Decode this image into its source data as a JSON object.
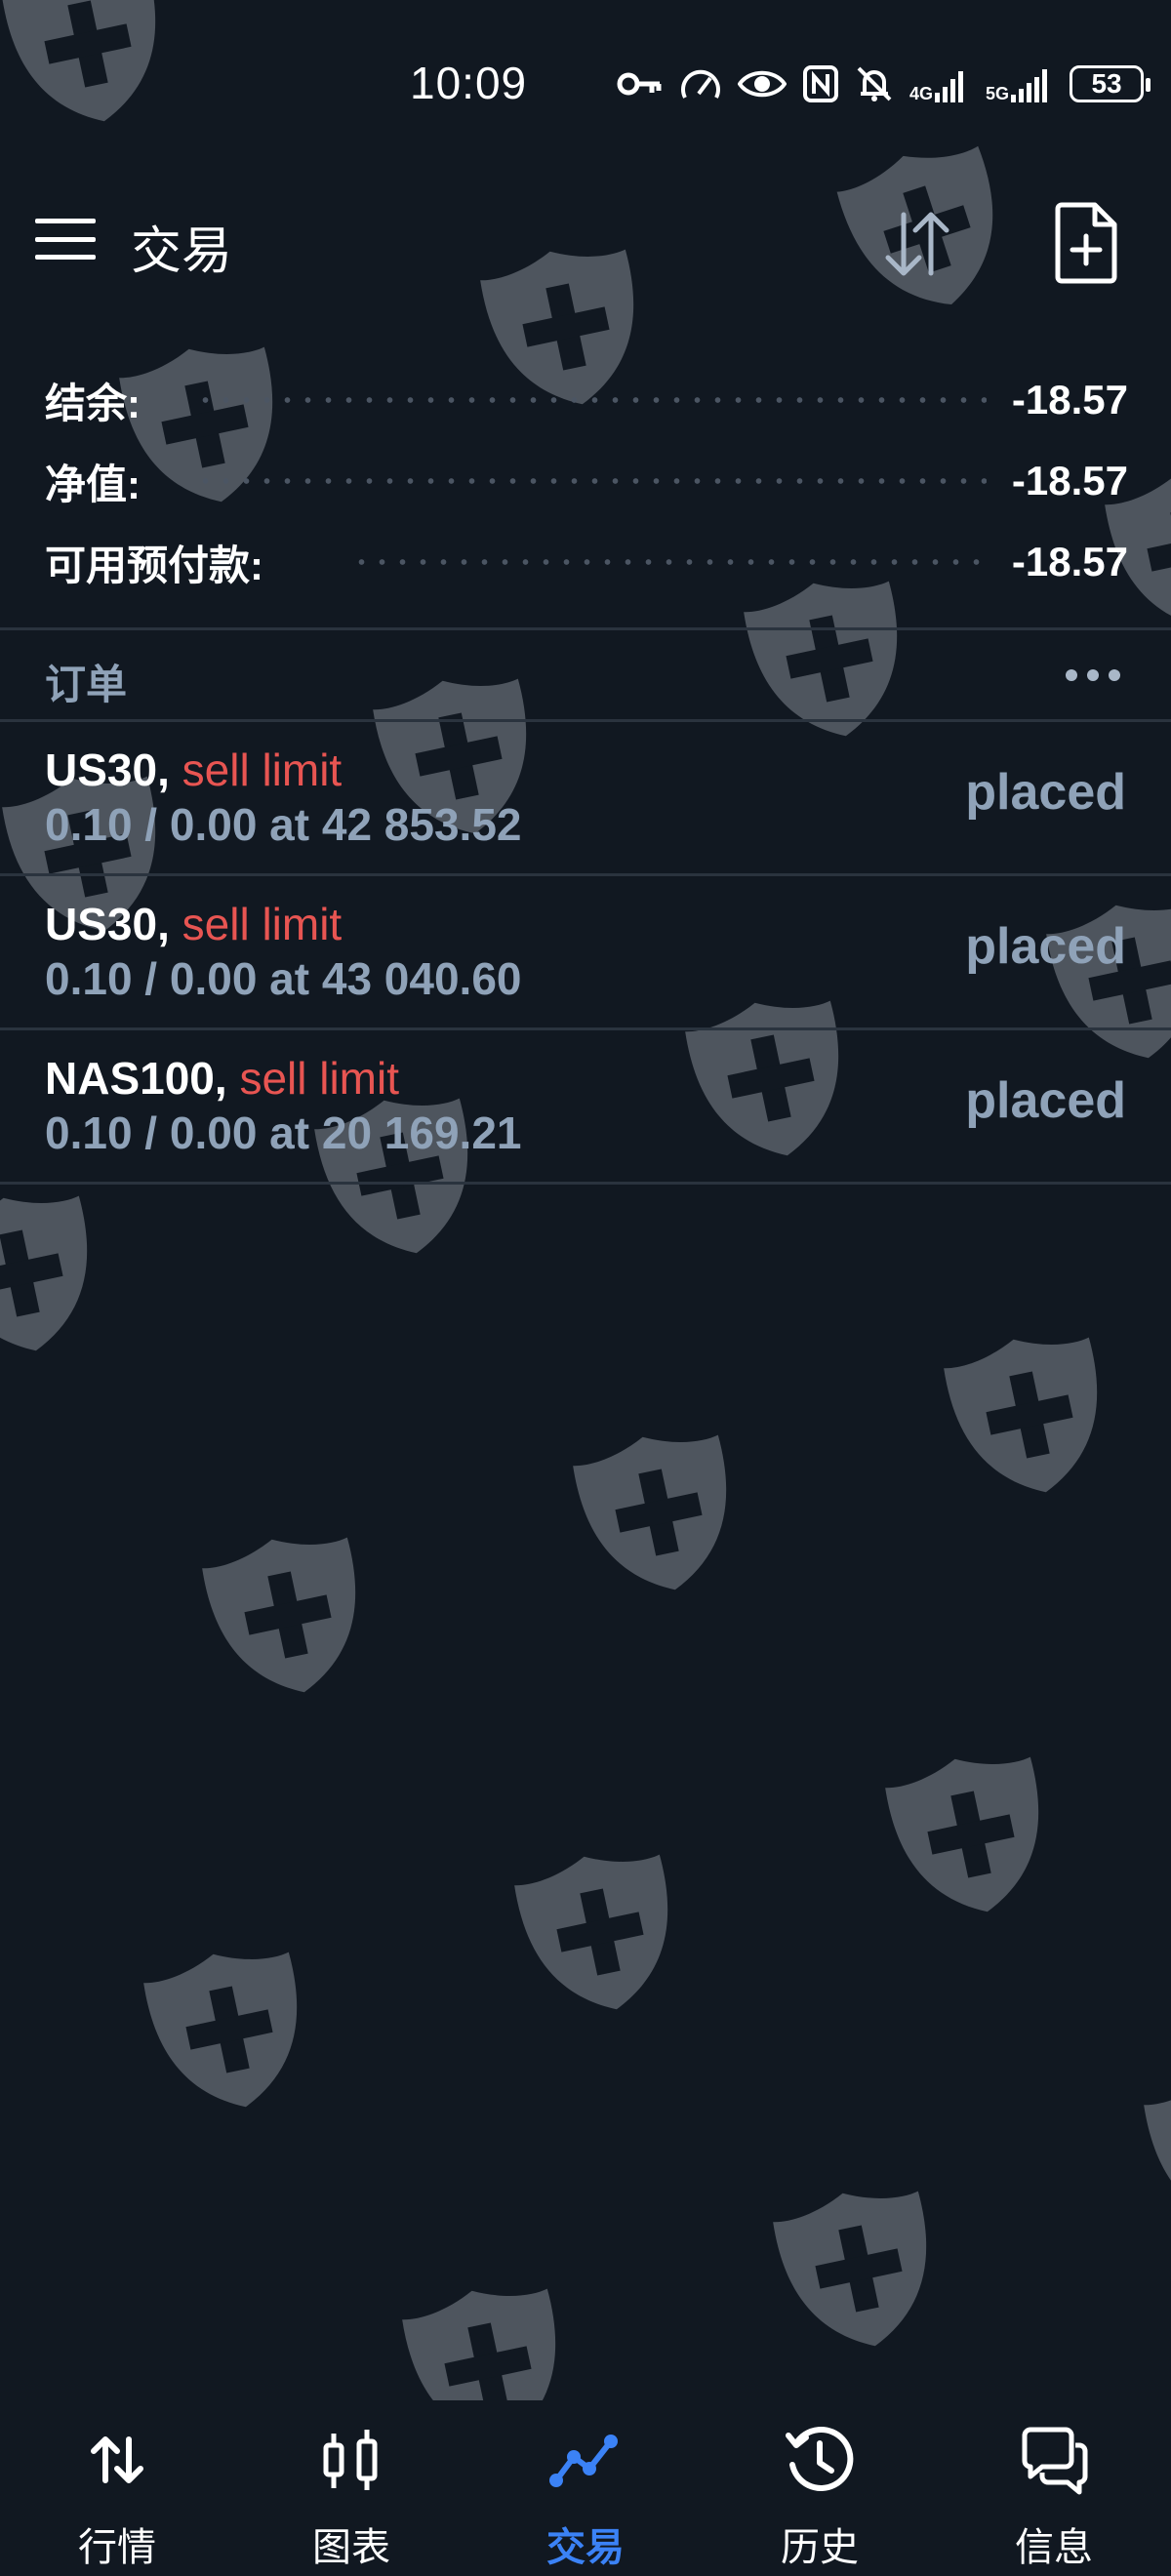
{
  "status_bar": {
    "time": "10:09",
    "net1": "4G",
    "net2": "5G",
    "battery": "53"
  },
  "app_bar": {
    "title": "交易"
  },
  "summary": [
    {
      "label": "结余:",
      "value": "-18.57"
    },
    {
      "label": "净值:",
      "value": "-18.57"
    },
    {
      "label": "可用预付款:",
      "value": "-18.57"
    }
  ],
  "orders_section": {
    "title": "订单"
  },
  "orders": [
    {
      "symbol": "US30,",
      "type": "sell limit",
      "details": "0.10 / 0.00 at 42 853.52",
      "status": "placed"
    },
    {
      "symbol": "US30,",
      "type": "sell limit",
      "details": "0.10 / 0.00 at 43 040.60",
      "status": "placed"
    },
    {
      "symbol": "NAS100,",
      "type": "sell limit",
      "details": "0.10 / 0.00 at 20 169.21",
      "status": "placed"
    }
  ],
  "nav": [
    {
      "label": "行情",
      "icon": "quotes-arrows-icon"
    },
    {
      "label": "图表",
      "icon": "candlestick-icon"
    },
    {
      "label": "交易",
      "icon": "trade-trend-icon",
      "active": true
    },
    {
      "label": "历史",
      "icon": "history-clock-icon"
    },
    {
      "label": "信息",
      "icon": "messages-icon"
    }
  ],
  "colors": {
    "background": "#111821",
    "accent": "#3b82f6",
    "sell": "#e85552",
    "muted": "#8fa2b8",
    "watermark": "#4e555e"
  }
}
